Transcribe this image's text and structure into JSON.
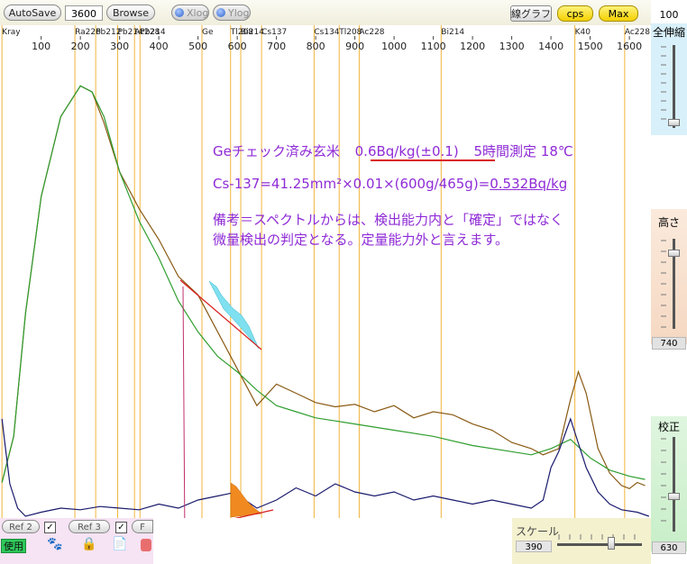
{
  "toolbar": {
    "autosave_label": "AutoSave",
    "time_value": "3600",
    "browse_label": "Browse",
    "xlog_label": "Xlog",
    "ylog_label": "Ylog",
    "line_graph_label": "線グラフ",
    "cps_label": "cps",
    "max_label": "Max"
  },
  "right_panel": {
    "top_value": "100",
    "zoom_all_label": "全伸縮",
    "height_label": "高さ",
    "height_value": "740",
    "calib_label": "校正",
    "calib_value": "630"
  },
  "bottom": {
    "ref2_label": "Ref 2",
    "ref3_label": "Ref 3",
    "ref_partial_label": "F",
    "use_label": "使用",
    "scale_label": "スケール",
    "scale_value": "390"
  },
  "annotations": {
    "line1": "Geチェック済み玄米",
    "line1_value": "0.6Bq/kg(±0.1)",
    "line1_tail": "5時間測定 18℃",
    "line2_prefix": "Cs-137=41.25mm²×0.01×(600g/465g)=",
    "line2_result": "0.532Bq/kg",
    "line3": "備考＝スペクトルからは、検出能力内と「確定」ではなく",
    "line4": "微量検出の判定となる。定量能力外と言えます。"
  },
  "colors": {
    "isotope_line": "#f0b43c",
    "brown_series": "#8a5a14",
    "green_series": "#2f9e2f",
    "navy_series": "#1a1a6e",
    "annotation_text": "#8f2bd6",
    "cs137_fill": "#7fe0f0",
    "peak_fill": "#f08a20",
    "baseline_red": "#d91e1e"
  },
  "chart_data": {
    "type": "line",
    "x_axis": {
      "range": [
        0,
        1650
      ],
      "ticks": [
        100,
        200,
        300,
        400,
        500,
        600,
        700,
        800,
        900,
        1000,
        1100,
        1200,
        1300,
        1400,
        1500,
        1600
      ]
    },
    "isotope_markers": [
      {
        "label": "Kray",
        "x": 0
      },
      {
        "label": "Ra226",
        "x": 186
      },
      {
        "label": "Pb212",
        "x": 239
      },
      {
        "label": "Pb214",
        "x": 295
      },
      {
        "label": "Ac228",
        "x": 338
      },
      {
        "label": "Pb214",
        "x": 352
      },
      {
        "label": "Ge",
        "x": 510
      },
      {
        "label": "Tl208",
        "x": 583
      },
      {
        "label": "Bi214",
        "x": 609
      },
      {
        "label": "Cs137",
        "x": 662
      },
      {
        "label": "Cs134",
        "x": 796
      },
      {
        "label": "Tl208",
        "x": 860
      },
      {
        "label": "Ac228",
        "x": 911
      },
      {
        "label": "Bi214",
        "x": 1120
      },
      {
        "label": "K40",
        "x": 1461
      },
      {
        "label": "Ac228",
        "x": 1588
      }
    ],
    "series": [
      {
        "style": "brown",
        "x": [
          0,
          30,
          60,
          100,
          150,
          200,
          230,
          260,
          300,
          350,
          400,
          450,
          500,
          550,
          600,
          650,
          700,
          750,
          800,
          850,
          900,
          950,
          1000,
          1050,
          1100,
          1150,
          1200,
          1250,
          1300,
          1350,
          1380,
          1420,
          1450,
          1470,
          1490,
          1520,
          1550,
          1580,
          1600,
          1620,
          1640
        ],
        "y": [
          55,
          130,
          330,
          520,
          650,
          700,
          690,
          640,
          560,
          500,
          450,
          390,
          360,
          300,
          240,
          180,
          215,
          200,
          185,
          178,
          182,
          170,
          180,
          160,
          170,
          165,
          150,
          140,
          120,
          110,
          100,
          110,
          190,
          235,
          200,
          110,
          70,
          50,
          45,
          55,
          50
        ]
      },
      {
        "style": "green",
        "x": [
          0,
          30,
          60,
          100,
          150,
          200,
          230,
          260,
          300,
          350,
          400,
          450,
          500,
          550,
          600,
          650,
          700,
          750,
          800,
          850,
          900,
          1000,
          1100,
          1200,
          1300,
          1350,
          1400,
          1450,
          1500,
          1550,
          1600,
          1640
        ],
        "y": [
          55,
          130,
          330,
          520,
          650,
          700,
          690,
          650,
          560,
          480,
          420,
          350,
          300,
          260,
          235,
          205,
          180,
          170,
          160,
          155,
          150,
          140,
          130,
          115,
          105,
          100,
          110,
          125,
          95,
          75,
          65,
          60
        ]
      },
      {
        "style": "navy",
        "x": [
          0,
          10,
          20,
          40,
          60,
          100,
          150,
          200,
          250,
          300,
          350,
          400,
          450,
          500,
          550,
          600,
          620,
          650,
          700,
          750,
          800,
          850,
          900,
          950,
          1000,
          1050,
          1100,
          1150,
          1200,
          1250,
          1300,
          1350,
          1380,
          1400,
          1420,
          1450,
          1470,
          1490,
          1520,
          1550,
          1580,
          1620,
          1650
        ],
        "y": [
          120,
          80,
          40,
          10,
          0,
          5,
          10,
          8,
          12,
          10,
          8,
          15,
          10,
          20,
          25,
          30,
          20,
          10,
          20,
          35,
          25,
          40,
          30,
          25,
          30,
          20,
          25,
          20,
          15,
          20,
          15,
          10,
          20,
          60,
          80,
          120,
          90,
          60,
          30,
          15,
          8,
          5,
          0
        ]
      }
    ]
  }
}
